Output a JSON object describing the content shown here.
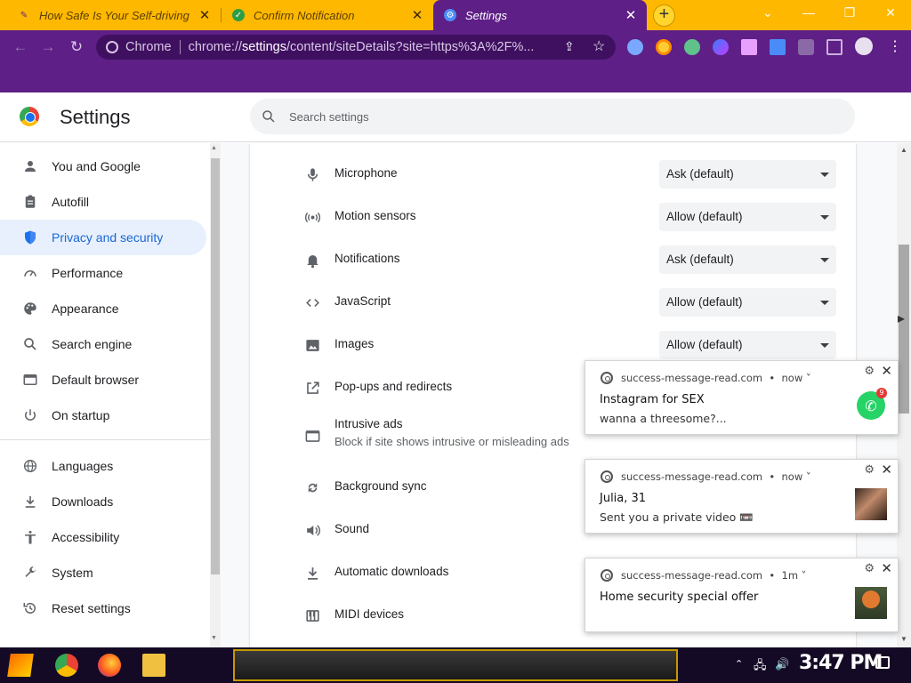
{
  "browser": {
    "tabs": [
      {
        "title": "How Safe Is Your Self-driving",
        "close": "✕"
      },
      {
        "title": "Confirm Notification",
        "close": "✕"
      },
      {
        "title": "Settings",
        "close": "✕"
      }
    ],
    "new_tab": "+",
    "window": {
      "minimize": "—",
      "restore": "❐",
      "close": "✕"
    },
    "nav": {
      "back": "←",
      "forward": "→",
      "reload": "↻"
    },
    "omnibox": {
      "site": "Chrome",
      "url_prefix": "chrome://",
      "url_bold": "settings",
      "url_rest": "/content/siteDetails?site=https%3A%2F%..."
    }
  },
  "settings": {
    "title": "Settings",
    "search_placeholder": "Search settings"
  },
  "sidebar": {
    "items": [
      {
        "label": "You and Google",
        "icon": "person-icon"
      },
      {
        "label": "Autofill",
        "icon": "clipboard-icon"
      },
      {
        "label": "Privacy and security",
        "icon": "shield-icon"
      },
      {
        "label": "Performance",
        "icon": "gauge-icon"
      },
      {
        "label": "Appearance",
        "icon": "palette-icon"
      },
      {
        "label": "Search engine",
        "icon": "search-icon"
      },
      {
        "label": "Default browser",
        "icon": "browser-window-icon"
      },
      {
        "label": "On startup",
        "icon": "power-icon"
      },
      {
        "label": "Languages",
        "icon": "globe-icon"
      },
      {
        "label": "Downloads",
        "icon": "download-icon"
      },
      {
        "label": "Accessibility",
        "icon": "accessibility-icon"
      },
      {
        "label": "System",
        "icon": "wrench-icon"
      },
      {
        "label": "Reset settings",
        "icon": "history-icon"
      }
    ],
    "selected": "Privacy and security"
  },
  "permissions": [
    {
      "label": "Microphone",
      "value": "Ask (default)",
      "icon": "microphone-icon"
    },
    {
      "label": "Motion sensors",
      "value": "Allow (default)",
      "icon": "motion-sensor-icon"
    },
    {
      "label": "Notifications",
      "value": "Ask (default)",
      "icon": "bell-icon"
    },
    {
      "label": "JavaScript",
      "value": "Allow (default)",
      "icon": "code-icon"
    },
    {
      "label": "Images",
      "value": "Allow (default)",
      "icon": "image-icon"
    },
    {
      "label": "Pop-ups and redirects",
      "icon": "popup-icon"
    },
    {
      "label": "Intrusive ads",
      "sublabel": "Block if site shows intrusive or misleading ads",
      "icon": "ads-icon"
    },
    {
      "label": "Background sync",
      "icon": "sync-icon"
    },
    {
      "label": "Sound",
      "icon": "speaker-icon"
    },
    {
      "label": "Automatic downloads",
      "icon": "download-icon"
    },
    {
      "label": "MIDI devices",
      "icon": "piano-icon"
    }
  ],
  "notifications": [
    {
      "source": "success-message-read.com",
      "time": "now",
      "title": "Instagram for SEX",
      "body": "wanna a threesome?...",
      "badge": "9",
      "image": "whatsapp-icon"
    },
    {
      "source": "success-message-read.com",
      "time": "now",
      "title": "Julia, 31",
      "body": "Sent you a private video 📼",
      "image": "photo-thumbnail"
    },
    {
      "source": "success-message-read.com",
      "time": "1m",
      "title": "Home security special offer",
      "body": "",
      "image": "sign-thumbnail"
    }
  ],
  "taskbar": {
    "clock": "3:47 PM"
  },
  "colors": {
    "accent": "#1a73e8",
    "tab_strip": "#ffb800",
    "toolbar": "#5e1f86",
    "selected_nav": "#e8f0fe"
  }
}
